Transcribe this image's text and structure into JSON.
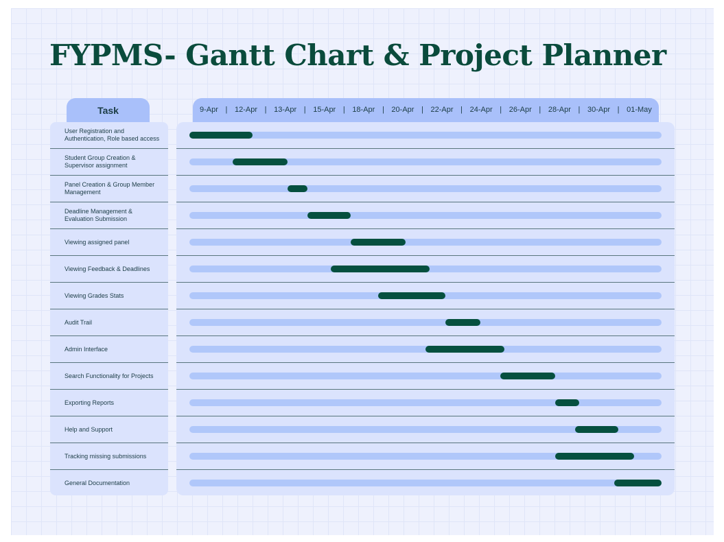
{
  "title": "FYPMS- Gantt Chart & Project Planner",
  "task_header": "Task",
  "colors": {
    "accent": "#06503f",
    "track": "#b0c7fa",
    "header": "#a9c0fa",
    "panel": "#dbe3fd"
  },
  "chart_data": {
    "type": "gantt",
    "title": "FYPMS- Gantt Chart & Project Planner",
    "x_ticks": [
      "9-Apr",
      "12-Apr",
      "13-Apr",
      "15-Apr",
      "18-Apr",
      "20-Apr",
      "22-Apr",
      "24-Apr",
      "26-Apr",
      "28-Apr",
      "30-Apr",
      "01-May"
    ],
    "x_range": [
      0,
      12
    ],
    "tasks": [
      {
        "name": "User Registration and Authentication, Role based access",
        "start": 0.0,
        "end": 1.6
      },
      {
        "name": "Student Group Creation & Supervisor assignment",
        "start": 1.1,
        "end": 2.5
      },
      {
        "name": "Panel Creation & Group Member Management",
        "start": 2.5,
        "end": 3.0
      },
      {
        "name": "Deadline Management & Evaluation Submission",
        "start": 3.0,
        "end": 4.1
      },
      {
        "name": "Viewing assigned panel",
        "start": 4.1,
        "end": 5.5
      },
      {
        "name": "Viewing Feedback & Deadlines",
        "start": 3.6,
        "end": 6.1
      },
      {
        "name": "Viewing Grades Stats",
        "start": 4.8,
        "end": 6.5
      },
      {
        "name": "Audit Trail",
        "start": 6.5,
        "end": 7.4
      },
      {
        "name": "Admin Interface",
        "start": 6.0,
        "end": 8.0
      },
      {
        "name": "Search Functionality for Projects",
        "start": 7.9,
        "end": 9.3
      },
      {
        "name": "Exporting Reports",
        "start": 9.3,
        "end": 9.9
      },
      {
        "name": "Help and Support",
        "start": 9.8,
        "end": 10.9
      },
      {
        "name": "Tracking missing submissions",
        "start": 9.3,
        "end": 11.3
      },
      {
        "name": "General Documentation",
        "start": 10.8,
        "end": 12.0
      }
    ]
  }
}
